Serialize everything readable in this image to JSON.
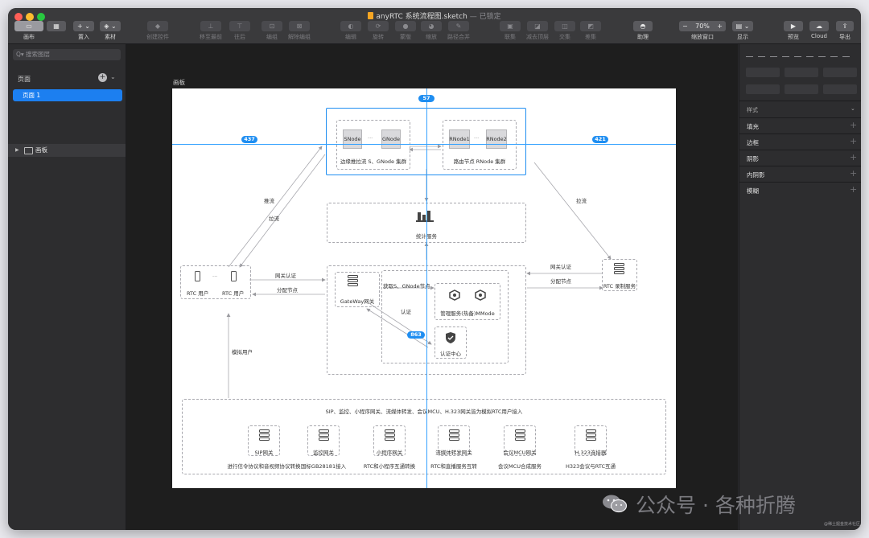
{
  "window": {
    "filename": "anyRTC 系统流程图.sketch",
    "status": "— 已锁定"
  },
  "toolbar": {
    "left": [
      {
        "label": "画布",
        "glyph": "▭",
        "active": true
      },
      {
        "label": "",
        "glyph": "▦",
        "active": false
      },
      {
        "label": "置入",
        "glyph": "+ ⌄"
      },
      {
        "label": "素材",
        "glyph": "◈ ⌄"
      }
    ],
    "middle": [
      {
        "label": "创建控件",
        "glyph": "◆"
      },
      {
        "label": "移至最前",
        "glyph": "⊥"
      },
      {
        "label": "往后",
        "glyph": "⊤"
      },
      {
        "label": "编组",
        "glyph": "⊡"
      },
      {
        "label": "解除编组",
        "glyph": "⊠"
      },
      {
        "label": "编辑",
        "glyph": "◐"
      },
      {
        "label": "旋转",
        "glyph": "⟳"
      },
      {
        "label": "蒙版",
        "glyph": "●"
      },
      {
        "label": "缩放",
        "glyph": "◕"
      },
      {
        "label": "路径合并",
        "glyph": "✎"
      },
      {
        "label": "联集",
        "glyph": "▣"
      },
      {
        "label": "减去顶层",
        "glyph": "◪"
      },
      {
        "label": "交集",
        "glyph": "◫"
      },
      {
        "label": "差集",
        "glyph": "◩"
      }
    ],
    "help": {
      "label": "助理",
      "glyph": "◓"
    },
    "zoom": {
      "label": "缩放窗口",
      "value": "70%",
      "minus": "−",
      "plus": "+"
    },
    "display": {
      "label": "显示",
      "glyph": "▤ ⌄"
    },
    "right": [
      {
        "label": "预览",
        "glyph": "▶"
      },
      {
        "label": "Cloud",
        "glyph": "☁"
      },
      {
        "label": "导出",
        "glyph": "⇪"
      }
    ]
  },
  "sidebar": {
    "search_placeholder": "Q▾ 搜索图层",
    "pages_header": "页面",
    "add_glyph": "+",
    "chevron": "⌄",
    "pages": [
      {
        "label": "页面 1",
        "selected": true
      }
    ],
    "layers": [
      {
        "label": "画板",
        "expand": "▶"
      }
    ]
  },
  "canvas": {
    "artboard_label": "画板",
    "badges": {
      "top": "57",
      "left": "437",
      "right": "421",
      "bottom": "863"
    }
  },
  "diagram": {
    "snode": "SNode",
    "gnode": "GNode",
    "rnode1": "RNode1",
    "rnode2": "RNode2",
    "ellipsis": "···",
    "edge_cluster": "边缘推拉流 S、GNode 集群",
    "route_cluster": "路由节点 RNode 集群",
    "stats": "统计服务",
    "push": "推流",
    "pull": "拉流",
    "pull_right": "拉流",
    "rtc_user": "RTC 用户",
    "gateway_auth": "网关认证",
    "assign_node": "分配节点",
    "gateway": "GateWay网关",
    "get_nodes": "获取S、GNode节点",
    "mgmt": "管理服务(热备)MMode",
    "auth_label": "认证",
    "auth_center": "认证中心",
    "gateway_auth_r": "网关认证",
    "assign_node_r": "分配节点",
    "recorder": "RTC 录制服务",
    "simulate_user": "模拟用户",
    "bottom_title": "SIP、监控、小程序网关、流媒体转发、会议MCU、H.323网关皆为模拟RTC用户接入",
    "gateways": [
      {
        "name": "SIP网关",
        "desc": "进行信令协议和音视频协议转换"
      },
      {
        "name": "监控网关",
        "desc": "国标GB28181接入"
      },
      {
        "name": "小程序网关",
        "desc": "RTC和小程序互通转换"
      },
      {
        "name": "流媒体转发网关",
        "desc": "RTC和直播服务互转"
      },
      {
        "name": "会议MCU网关",
        "desc": "会议MCU合成服务"
      },
      {
        "name": "H.323连接器",
        "desc": "H323会议与RTC互通"
      }
    ]
  },
  "inspector": {
    "style_title": "样式",
    "chevron": "⌄",
    "sections": [
      {
        "name": "填充",
        "plus": "+"
      },
      {
        "name": "边框",
        "plus": "+"
      },
      {
        "name": "阴影",
        "plus": "+"
      },
      {
        "name": "内阴影",
        "plus": "+"
      },
      {
        "name": "模糊",
        "plus": "+"
      }
    ]
  },
  "watermark": {
    "text": "公众号 · 各种折腾",
    "small": "@稀土掘金技术社区"
  },
  "colors": {
    "accent": "#1f8ef1",
    "selection": "#1c7ff0"
  }
}
